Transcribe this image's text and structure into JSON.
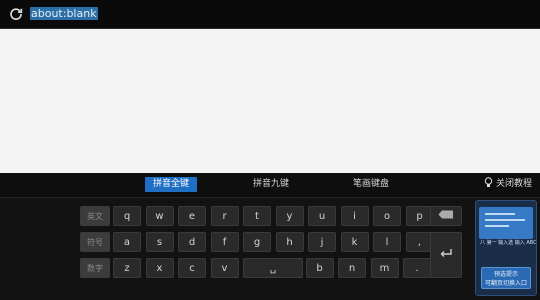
{
  "address_bar": {
    "url": "about:blank"
  },
  "ime": {
    "tabs": [
      "拼音全键",
      "拼音九键",
      "笔画键盘"
    ],
    "active_tab": 0,
    "tip_label": "关闭教程",
    "row1": [
      "q",
      "w",
      "e",
      "r",
      "t",
      "y",
      "u",
      "i",
      "o",
      "p"
    ],
    "row2": [
      "a",
      "s",
      "d",
      "f",
      "g",
      "h",
      "j",
      "k",
      "l",
      ","
    ],
    "row3": [
      "z",
      "x",
      "c",
      "v",
      "␣",
      "b",
      "n",
      "m",
      "."
    ],
    "left_fn": [
      "英文",
      "符号",
      "数字"
    ],
    "panel": {
      "options": "八 第一 输入选 输入 ABC",
      "button_line1": "预选提示",
      "button_line2": "可翻页切换入口"
    }
  }
}
